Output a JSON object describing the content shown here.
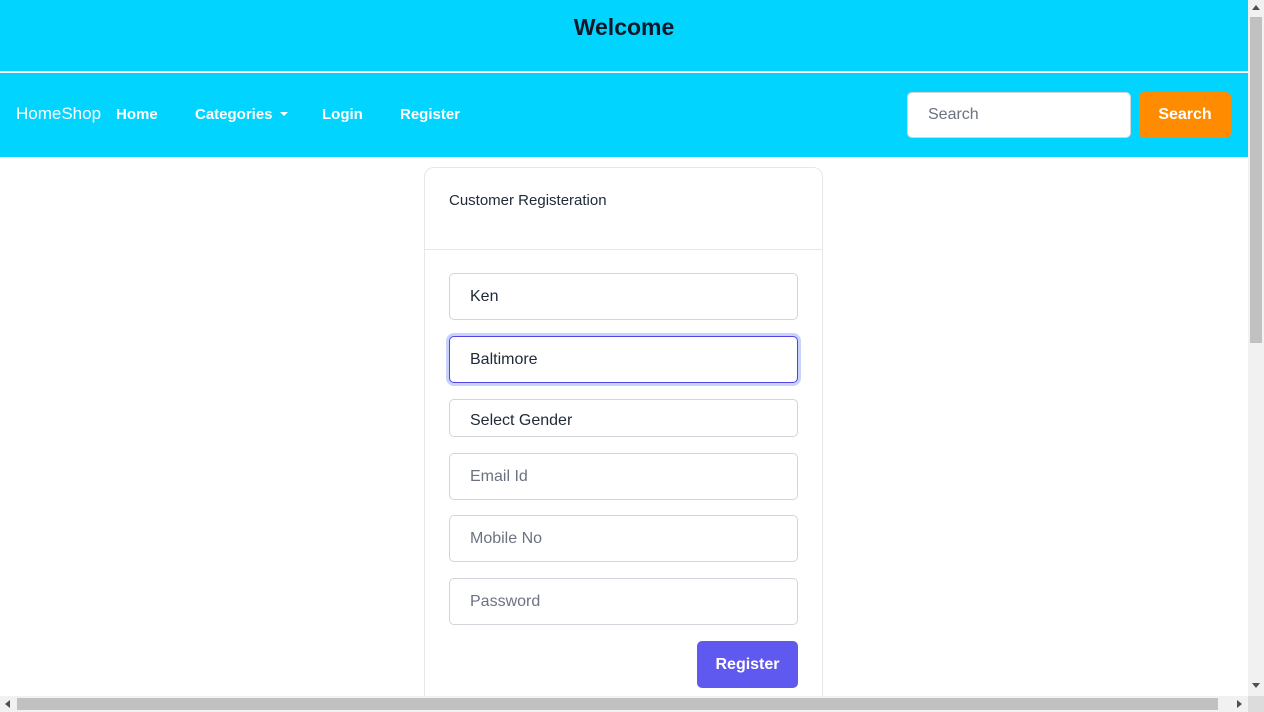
{
  "banner": {
    "title": "Welcome"
  },
  "navbar": {
    "brand": "HomeShop",
    "links": {
      "home": "Home",
      "categories": "Categories",
      "login": "Login",
      "register": "Register"
    },
    "search": {
      "placeholder": "Search",
      "button_label": "Search"
    }
  },
  "form": {
    "title": "Customer Registeration",
    "first_name": {
      "value": "Ken"
    },
    "last_name": {
      "value": "Baltimore"
    },
    "gender": {
      "selected": "Select Gender"
    },
    "email": {
      "placeholder": "Email Id"
    },
    "mobile": {
      "placeholder": "Mobile No"
    },
    "password": {
      "placeholder": "Password"
    },
    "submit_label": "Register"
  },
  "colors": {
    "header_bg": "#00d4ff",
    "search_button_bg": "#ff8c00",
    "register_button_bg": "#6059f0",
    "focus_border": "#4f46e5"
  }
}
